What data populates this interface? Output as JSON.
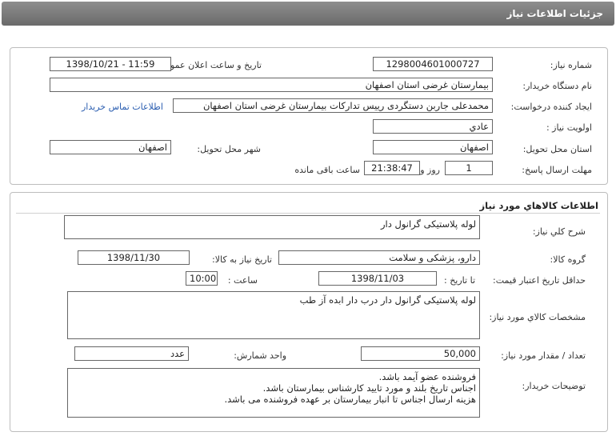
{
  "header": {
    "title": "جزئیات اطلاعات نیاز"
  },
  "info": {
    "need_number_label": "شماره نیاز:",
    "need_number": "1298004601000727",
    "announce_label": "تاریخ و ساعت اعلان عمومی:",
    "announce_value": "1398/10/21 - 11:59",
    "buyer_org_label": "نام دستگاه خریدار:",
    "buyer_org": "بیمارستان غرضی استان اصفهان",
    "creator_label": "ایجاد کننده درخواست:",
    "creator": "محمدعلی جاربن دستگردی رییس تدارکات بیمارستان غرضی استان اصفهان",
    "contact_link": "اطلاعات تماس خریدار",
    "priority_label": "اولویت نیاز :",
    "priority": "عادي",
    "province_label": "استان محل تحویل:",
    "province": "اصفهان",
    "city_label": "شهر محل تحویل:",
    "city": "اصفهان",
    "deadline_label": "مهلت ارسال پاسخ:",
    "deadline_days": "1",
    "days_label": "روز و",
    "deadline_time": "21:38:47",
    "remaining_label": "ساعت باقی مانده"
  },
  "goods": {
    "section_title": "اطلاعات کالاهاي مورد نياز",
    "desc_label": "شرح کلي نياز:",
    "desc": "لوله پلاستیکی گرانول دار",
    "group_label": "گروه کالا:",
    "group": "دارو، پزشکی و سلامت",
    "need_date_label": "تاریخ نیاز به کالا:",
    "need_date": "1398/11/30",
    "price_validity_label": "حداقل تاریخ اعتبار قیمت:",
    "until_date_label": "تا تاریخ :",
    "until_date": "1398/11/03",
    "time_label": "ساعت :",
    "time": "10:00",
    "spec_label": "مشخصات کالاي مورد نياز:",
    "spec": "لوله پلاستیکی گرانول دار درب دار ابده آز طب",
    "qty_label": "تعداد / مقدار مورد نیاز:",
    "qty": "50,000",
    "unit_label": "واحد شمارش:",
    "unit": "عدد",
    "notes_label": "توضیحات خریدار:",
    "notes_line1": "فروشنده عضو آیمد باشد.",
    "notes_line2": "اجناس تاریخ بلند و مورد تایید کارشناس بیمارستان باشد.",
    "notes_line3": "هزینه ارسال اجناس تا انبار بیمارستان بر عهده فروشنده می باشد."
  }
}
